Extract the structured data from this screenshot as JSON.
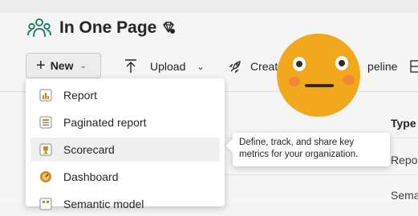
{
  "workspace": {
    "title": "In One Page"
  },
  "toolbar": {
    "new_label": "New",
    "upload_label": "Upload",
    "create_label": "Create",
    "pipeline_label": "peline"
  },
  "new_menu": {
    "items": [
      {
        "label": "Report",
        "icon": "report-icon"
      },
      {
        "label": "Paginated report",
        "icon": "paginated-report-icon"
      },
      {
        "label": "Scorecard",
        "icon": "scorecard-icon"
      },
      {
        "label": "Dashboard",
        "icon": "dashboard-icon"
      },
      {
        "label": "Semantic model",
        "icon": "semantic-model-icon"
      }
    ]
  },
  "tooltip": {
    "text": "Define, track, and share key metrics for your organization."
  },
  "table": {
    "type_header": "Type",
    "cells": [
      "Repo",
      "Sema"
    ]
  },
  "overlay": {
    "icon": "neutral-face-emoji"
  }
}
